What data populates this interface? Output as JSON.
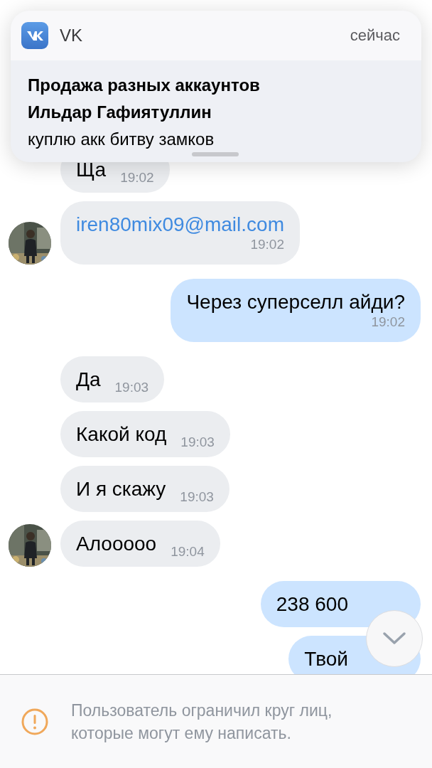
{
  "notification": {
    "app": "VK",
    "time": "сейчас",
    "title": "Продажа разных аккаунтов",
    "sender": "Ильдар Гафиятуллин",
    "text": "куплю акк битву замков"
  },
  "messages": [
    {
      "kind": "incoming",
      "avatar": false,
      "link": false,
      "time_below": false,
      "text": "Ща",
      "time": "19:02"
    },
    {
      "kind": "incoming",
      "avatar": true,
      "link": true,
      "time_below": true,
      "text": "iren80mix09@mail.com",
      "time": "19:02"
    },
    {
      "kind": "outgoing",
      "link": false,
      "time_below": true,
      "text": "Через суперселл айди?",
      "time": "19:02"
    },
    {
      "kind": "incoming",
      "avatar": false,
      "link": false,
      "time_below": false,
      "text": "Да",
      "time": "19:03"
    },
    {
      "kind": "incoming",
      "avatar": false,
      "link": false,
      "time_below": false,
      "text": "Какой код",
      "time": "19:03"
    },
    {
      "kind": "incoming",
      "avatar": false,
      "link": false,
      "time_below": false,
      "text": "И я скажу",
      "time": "19:03"
    },
    {
      "kind": "incoming",
      "avatar": true,
      "link": false,
      "time_below": false,
      "text": "Алооооо",
      "time": "19:04"
    },
    {
      "kind": "outgoing",
      "link": false,
      "time_below": false,
      "text": "238 600"
    },
    {
      "kind": "outgoing",
      "link": false,
      "time_below": false,
      "text": "Твой"
    }
  ],
  "footer": {
    "text": "Пользователь ограничил круг лиц, которые могут ему написать."
  }
}
